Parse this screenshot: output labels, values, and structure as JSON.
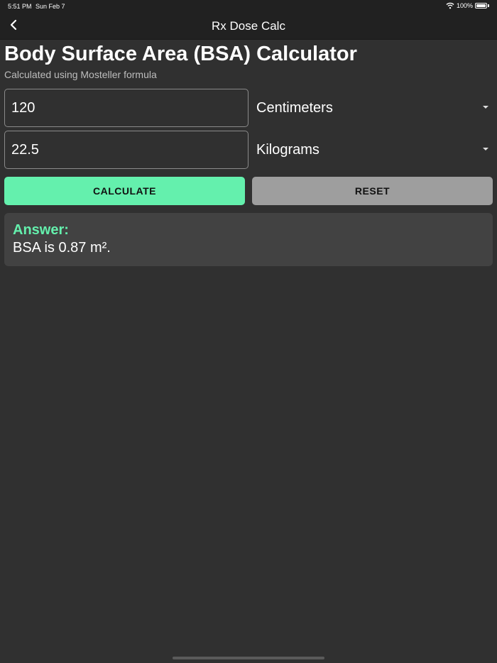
{
  "status_bar": {
    "time": "5:51 PM",
    "date": "Sun Feb 7",
    "battery": "100%",
    "icons": [
      "wifi-icon",
      "battery-icon"
    ]
  },
  "nav": {
    "title": "Rx Dose Calc",
    "back_icon": "chevron-left-icon"
  },
  "page": {
    "title": "Body Surface Area (BSA) Calculator",
    "subtitle": "Calculated using Mosteller formula"
  },
  "form": {
    "height": {
      "value": "120",
      "unit": "Centimeters"
    },
    "weight": {
      "value": "22.5",
      "unit": "Kilograms"
    }
  },
  "buttons": {
    "calculate": "CALCULATE",
    "reset": "RESET"
  },
  "answer": {
    "heading": "Answer:",
    "text": "BSA is 0.87 m²."
  },
  "colors": {
    "background": "#303030",
    "bar": "#212121",
    "accent": "#64f0ad",
    "reset_button": "#9e9e9e",
    "card": "#424242"
  }
}
